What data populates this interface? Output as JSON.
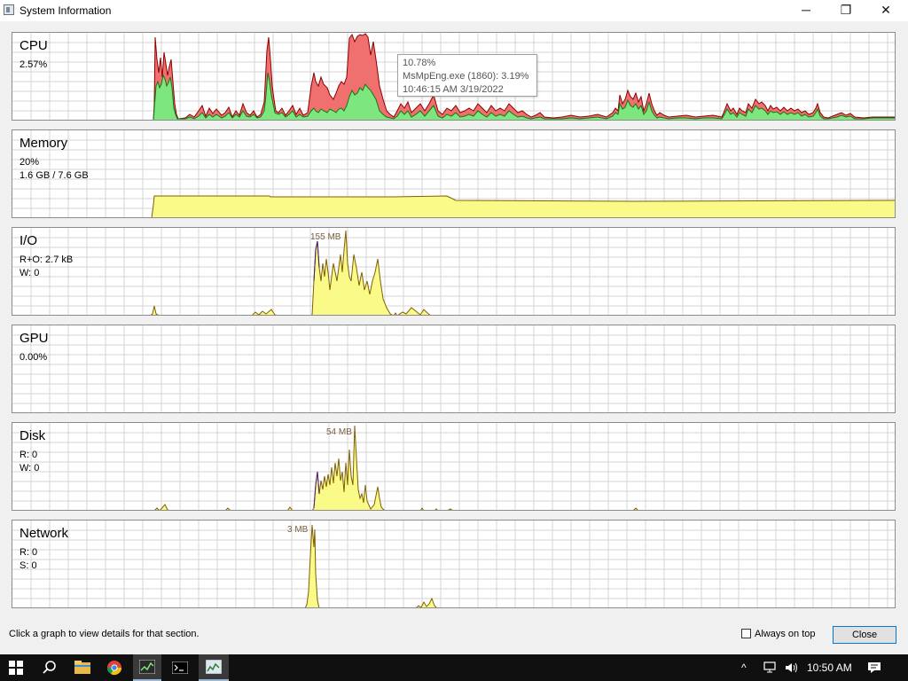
{
  "window": {
    "title": "System Information",
    "minimize_symbol": "─",
    "maximize_symbol": "❐",
    "close_symbol": "✕"
  },
  "panels": {
    "cpu": {
      "title": "CPU",
      "line1": "2.57%"
    },
    "memory": {
      "title": "Memory",
      "line1": "20%",
      "line2": "1.6 GB / 7.6 GB"
    },
    "io": {
      "title": "I/O",
      "line1": "R+O: 2.7 kB",
      "line2": "W: 0",
      "peak": "155 MB"
    },
    "gpu": {
      "title": "GPU",
      "line1": "0.00%"
    },
    "disk": {
      "title": "Disk",
      "line1": "R: 0",
      "line2": "W: 0",
      "peak": "54 MB"
    },
    "network": {
      "title": "Network",
      "line1": "R: 0",
      "line2": "S: 0",
      "peak": "3 MB"
    }
  },
  "tooltip": {
    "line1": "10.78%",
    "line2": "MsMpEng.exe (1860): 3.19%",
    "line3": "10:46:15 AM 3/19/2022"
  },
  "footer": {
    "status": "Click a graph to view details for that section.",
    "always_on_top_label": "Always on top",
    "always_on_top_checked": false,
    "close_label": "Close"
  },
  "taskbar": {
    "icons": [
      "windows-start-icon",
      "search-icon",
      "file-explorer-icon",
      "chrome-icon",
      "system-informer-icon",
      "command-prompt-icon",
      "system-info-window-icon"
    ],
    "tray": {
      "chevron": "^",
      "time": "10:50 AM"
    }
  },
  "colors": {
    "cpu_user": "#7ee67e",
    "cpu_kernel": "#f07070",
    "fill_yellow": "#fafa88",
    "grid": "#d4d4d4",
    "accent": "#0078d7"
  }
}
